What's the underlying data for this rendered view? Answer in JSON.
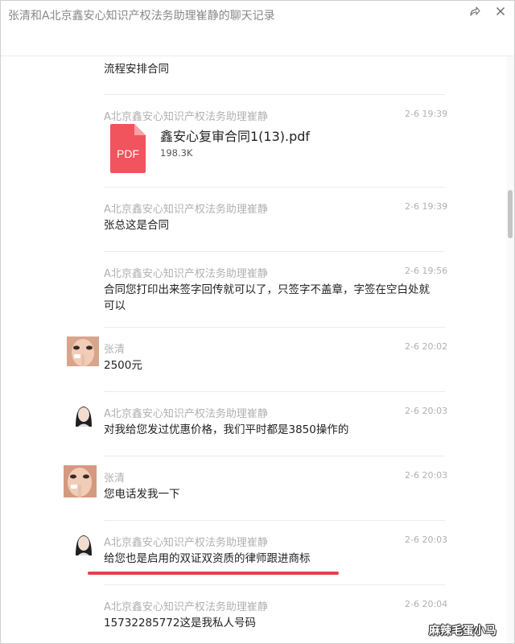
{
  "window": {
    "title": "张清和A北京鑫安心知识产权法务助理崔静的聊天记录"
  },
  "messages": [
    {
      "text": "流程安排合同"
    },
    {
      "sender": "A北京鑫安心知识产权法务助理崔静",
      "time": "2-6 19:39",
      "file_name": "鑫安心复审合同1(13).pdf",
      "file_size": "198.3K",
      "file_badge": "PDF"
    },
    {
      "sender": "A北京鑫安心知识产权法务助理崔静",
      "time": "2-6 19:39",
      "text": "张总这是合同"
    },
    {
      "sender": "A北京鑫安心知识产权法务助理崔静",
      "time": "2-6 19:56",
      "text": "合同您打印出来签字回传就可以了，只签字不盖章，字签在空白处就可以"
    },
    {
      "sender": "张清",
      "time": "2-6 20:02",
      "text": "2500元"
    },
    {
      "sender": "A北京鑫安心知识产权法务助理崔静",
      "time": "2-6 20:03",
      "text": "对我给您发过优惠价格，我们平时都是3850操作的"
    },
    {
      "sender": "张清",
      "time": "2-6 20:03",
      "text": "您电话发我一下"
    },
    {
      "sender": "A北京鑫安心知识产权法务助理崔静",
      "time": "2-6 20:03",
      "text": "给您也是启用的双证双资质的律师跟进商标"
    },
    {
      "sender": "A北京鑫安心知识产权法务助理崔静",
      "time": "2-6 20:04",
      "text": "15732285772这是我私人号码"
    }
  ],
  "watermark": "麻辣毛蛋小马",
  "colors": {
    "name": "#b0b0b0",
    "pdf_red": "#f1545c",
    "highlight_line": "#e8404a"
  },
  "icons": {
    "share": "share-icon",
    "close": "close-icon",
    "file": "pdf-file-icon"
  }
}
